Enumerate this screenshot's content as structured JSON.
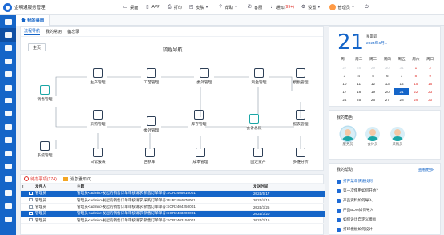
{
  "app": {
    "title": "企明通服务管理"
  },
  "toolbar": {
    "items": [
      {
        "icon": "desktop-icon",
        "label": "桌面"
      },
      {
        "icon": "app-icon",
        "label": "APP"
      },
      {
        "icon": "print-icon",
        "label": "打印"
      },
      {
        "icon": "skin-icon",
        "label": "皮肤"
      },
      {
        "icon": "help-icon",
        "label": "帮助"
      },
      {
        "icon": "service-icon",
        "label": "客服"
      },
      {
        "icon": "bell-icon",
        "label": "通知",
        "badge": "(99+)"
      },
      {
        "icon": "gear-icon",
        "label": "设置"
      }
    ],
    "user": "管理员"
  },
  "tabstrip": {
    "home_label": "我的桌面"
  },
  "main": {
    "subtabs": [
      "流程导航",
      "我的常用",
      "备忘录"
    ],
    "home_button": "主页",
    "flow_title": "流程导航",
    "nodes": {
      "sales": "销售管理",
      "production": "生产管理",
      "process": "工艺管理",
      "outsourcing": "委外管理",
      "capital": "资金管理",
      "template": "模板管理",
      "purchase": "采购管理",
      "warehouse": "库存管理",
      "accounting": "会计总账",
      "report": "报表管理",
      "craft": "委外管理",
      "system": "系统管理",
      "routine": "日常报表",
      "return": "回执单",
      "cost": "成本管理",
      "asset": "固定资产",
      "multi": "多维分析"
    }
  },
  "calendar": {
    "day": "21",
    "weekday": "星期四",
    "year_month": "2024年6月",
    "headers": [
      "周一",
      "周二",
      "周三",
      "周四",
      "周五",
      "周六",
      "周日"
    ],
    "rows": [
      [
        "27",
        "28",
        "29",
        "30",
        "31",
        "1",
        "2"
      ],
      [
        "3",
        "4",
        "5",
        "6",
        "7",
        "8",
        "9"
      ],
      [
        "10",
        "11",
        "12",
        "13",
        "14",
        "15",
        "16"
      ],
      [
        "17",
        "18",
        "19",
        "20",
        "21",
        "22",
        "23"
      ],
      [
        "24",
        "25",
        "26",
        "27",
        "28",
        "29",
        "30"
      ]
    ]
  },
  "team": {
    "title": "我的角色",
    "members": [
      "服务员",
      "会计员",
      "采购员"
    ]
  },
  "help": {
    "title": "我的帮助",
    "more": "查看更多",
    "items": [
      "打开菜单快速找到",
      "第一次使用如何开始？",
      "产品资料如何导入",
      "产品BOM如何导入",
      "如何设计自定义模板",
      "打印模板如何设计"
    ]
  },
  "bottom": {
    "tabs": [
      {
        "label": "待办事项(174)"
      },
      {
        "label": "消息通知(0)"
      }
    ],
    "columns": [
      "",
      "发件人",
      "主题",
      "发送时间"
    ],
    "rows": [
      {
        "sender": "管理员",
        "subject": "管理员<admin>发起的销售订单审核请求,销售订单单号:SOR2405010001",
        "time": "2024/5/17"
      },
      {
        "sender": "管理员",
        "subject": "管理员<admin>发起的销售订单审核请求,采购订单单号:PUR2404070001",
        "time": "2024/4/16"
      },
      {
        "sender": "管理员",
        "subject": "管理员<admin>发起的销售订单审核请求,销售订单单号:SOR2404250001",
        "time": "2024/3/25"
      },
      {
        "sender": "管理员",
        "subject": "管理员<admin>发起的销售订单审核请求,销售订单单号:SOR2403200001",
        "time": "2024/3/20"
      },
      {
        "sender": "管理员",
        "subject": "管理员<admin>发起的销售订单审核请求,销售订单单号:SOR2403150001",
        "time": "2024/3/15"
      }
    ]
  }
}
